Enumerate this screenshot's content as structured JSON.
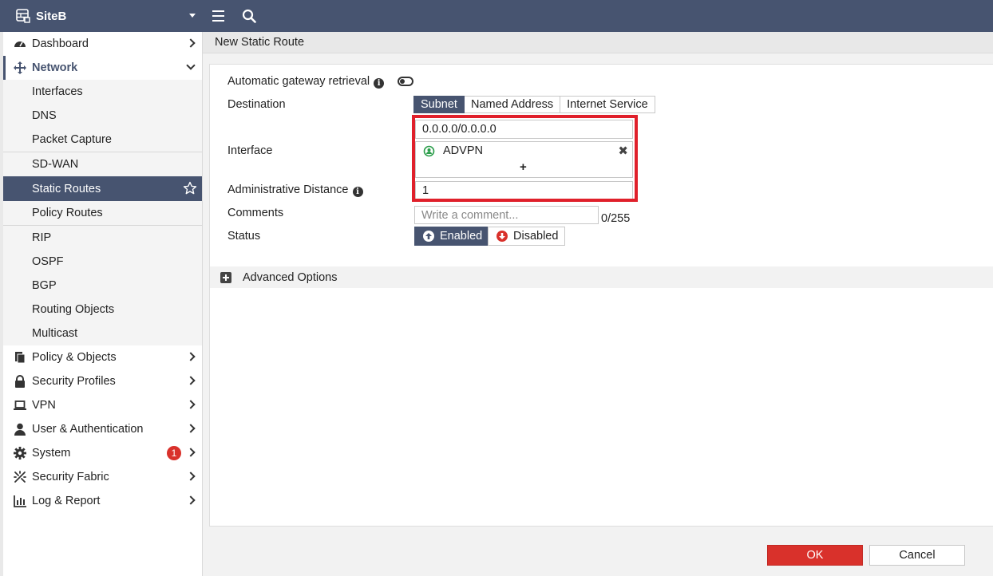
{
  "topbar": {
    "site_name": "SiteB",
    "icons": [
      "firewall-icon",
      "caret-down-icon",
      "hamburger-menu-icon",
      "search-icon"
    ]
  },
  "sidebar": {
    "items": [
      {
        "label": "Dashboard",
        "icon": "dashboard-icon"
      },
      {
        "label": "Network",
        "icon": "network-icon",
        "expanded": true
      },
      {
        "label": "Interfaces"
      },
      {
        "label": "DNS"
      },
      {
        "label": "Packet Capture"
      },
      {
        "label": "SD-WAN"
      },
      {
        "label": "Static Routes",
        "active": true
      },
      {
        "label": "Policy Routes"
      },
      {
        "label": "RIP"
      },
      {
        "label": "OSPF"
      },
      {
        "label": "BGP"
      },
      {
        "label": "Routing Objects"
      },
      {
        "label": "Multicast"
      },
      {
        "label": "Policy & Objects",
        "icon": "policy-icon"
      },
      {
        "label": "Security Profiles",
        "icon": "lock-icon"
      },
      {
        "label": "VPN",
        "icon": "laptop-icon"
      },
      {
        "label": "User & Authentication",
        "icon": "user-icon"
      },
      {
        "label": "System",
        "icon": "gear-icon",
        "badge": "1"
      },
      {
        "label": "Security Fabric",
        "icon": "fabric-icon"
      },
      {
        "label": "Log & Report",
        "icon": "chart-icon"
      }
    ]
  },
  "page": {
    "title": "New Static Route"
  },
  "form": {
    "auto_gateway_label": "Automatic gateway retrieval",
    "destination_label": "Destination",
    "destination_options": [
      "Subnet",
      "Named Address",
      "Internet Service"
    ],
    "destination_selected": "Subnet",
    "destination_value": "0.0.0.0/0.0.0.0",
    "interface_label": "Interface",
    "interface_value": "ADVPN",
    "interface_add": "+",
    "interface_remove": "✖",
    "admin_distance_label": "Administrative Distance",
    "admin_distance_value": "1",
    "comments_label": "Comments",
    "comments_placeholder": "Write a comment...",
    "comments_counter": "0/255",
    "status_label": "Status",
    "status_enabled": "Enabled",
    "status_disabled": "Disabled",
    "advanced_label": "Advanced Options"
  },
  "footer": {
    "ok_label": "OK",
    "cancel_label": "Cancel"
  },
  "colors": {
    "header": "#475470",
    "ok": "#d9312b",
    "highlight": "#e0202b"
  }
}
